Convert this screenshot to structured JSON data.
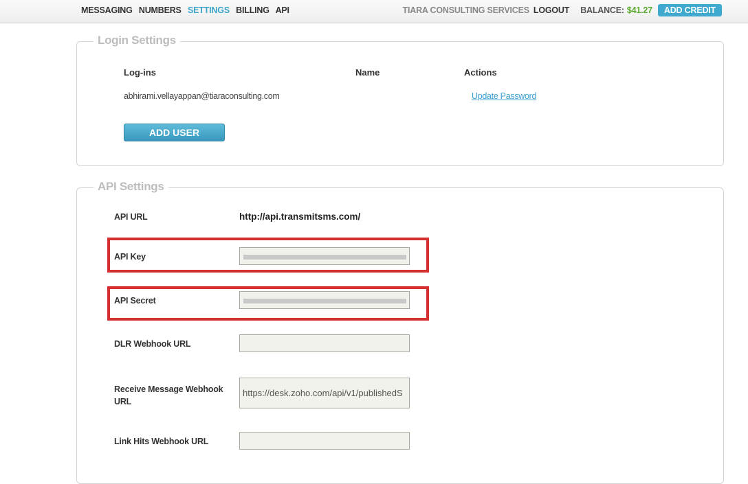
{
  "nav": {
    "items": [
      {
        "label": "MESSAGING"
      },
      {
        "label": "NUMBERS"
      },
      {
        "label": "SETTINGS",
        "active": true
      },
      {
        "label": "BILLING"
      },
      {
        "label": "API"
      }
    ],
    "company": "TIARA CONSULTING SERVICES",
    "logout": "LOGOUT",
    "balance_label": "BALANCE:",
    "balance_value": "$41.27",
    "add_credit": "ADD CREDIT"
  },
  "login_settings": {
    "legend": "Login Settings",
    "columns": [
      "Log-ins",
      "Name",
      "Actions"
    ],
    "rows": [
      {
        "login": "abhirami.vellayappan@tiaraconsulting.com",
        "name": "",
        "action": "Update Password"
      }
    ],
    "add_user_label": "ADD USER"
  },
  "api_settings": {
    "legend": "API Settings",
    "api_url_label": "API URL",
    "api_url_value": "http://api.transmitsms.com/",
    "api_key_label": "API Key",
    "api_key_value": "",
    "api_secret_label": "API Secret",
    "api_secret_value": "",
    "dlr_webhook_label": "DLR Webhook URL",
    "dlr_webhook_value": "",
    "receive_webhook_label": "Receive Message Webhook URL",
    "receive_webhook_value": "https://desk.zoho.com/api/v1/publishedS",
    "link_hits_label": "Link Hits Webhook URL",
    "link_hits_value": ""
  },
  "colors": {
    "accent": "#3fa9cf",
    "balance": "#5aa830",
    "highlight": "#d62f2f"
  }
}
